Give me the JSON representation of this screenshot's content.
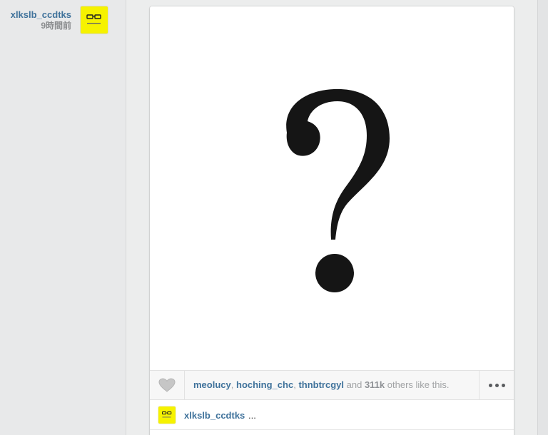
{
  "post": {
    "username": "xlkslb_ccdtks",
    "time_ago": "9時間前",
    "image_subject": "question-mark",
    "colors": {
      "avatar_bg": "#f6f200",
      "link": "#3f729b"
    }
  },
  "likes": {
    "users": [
      "meolucy",
      "hoching_chc",
      "thnbtrcgyl"
    ],
    "separator": ",",
    "and_label": "and",
    "count": "311k",
    "suffix": "others like this."
  },
  "caption": {
    "username": "xlkslb_ccdtks",
    "text": "..."
  },
  "icons": {
    "like": "heart-icon",
    "more": "more-options-icon"
  }
}
